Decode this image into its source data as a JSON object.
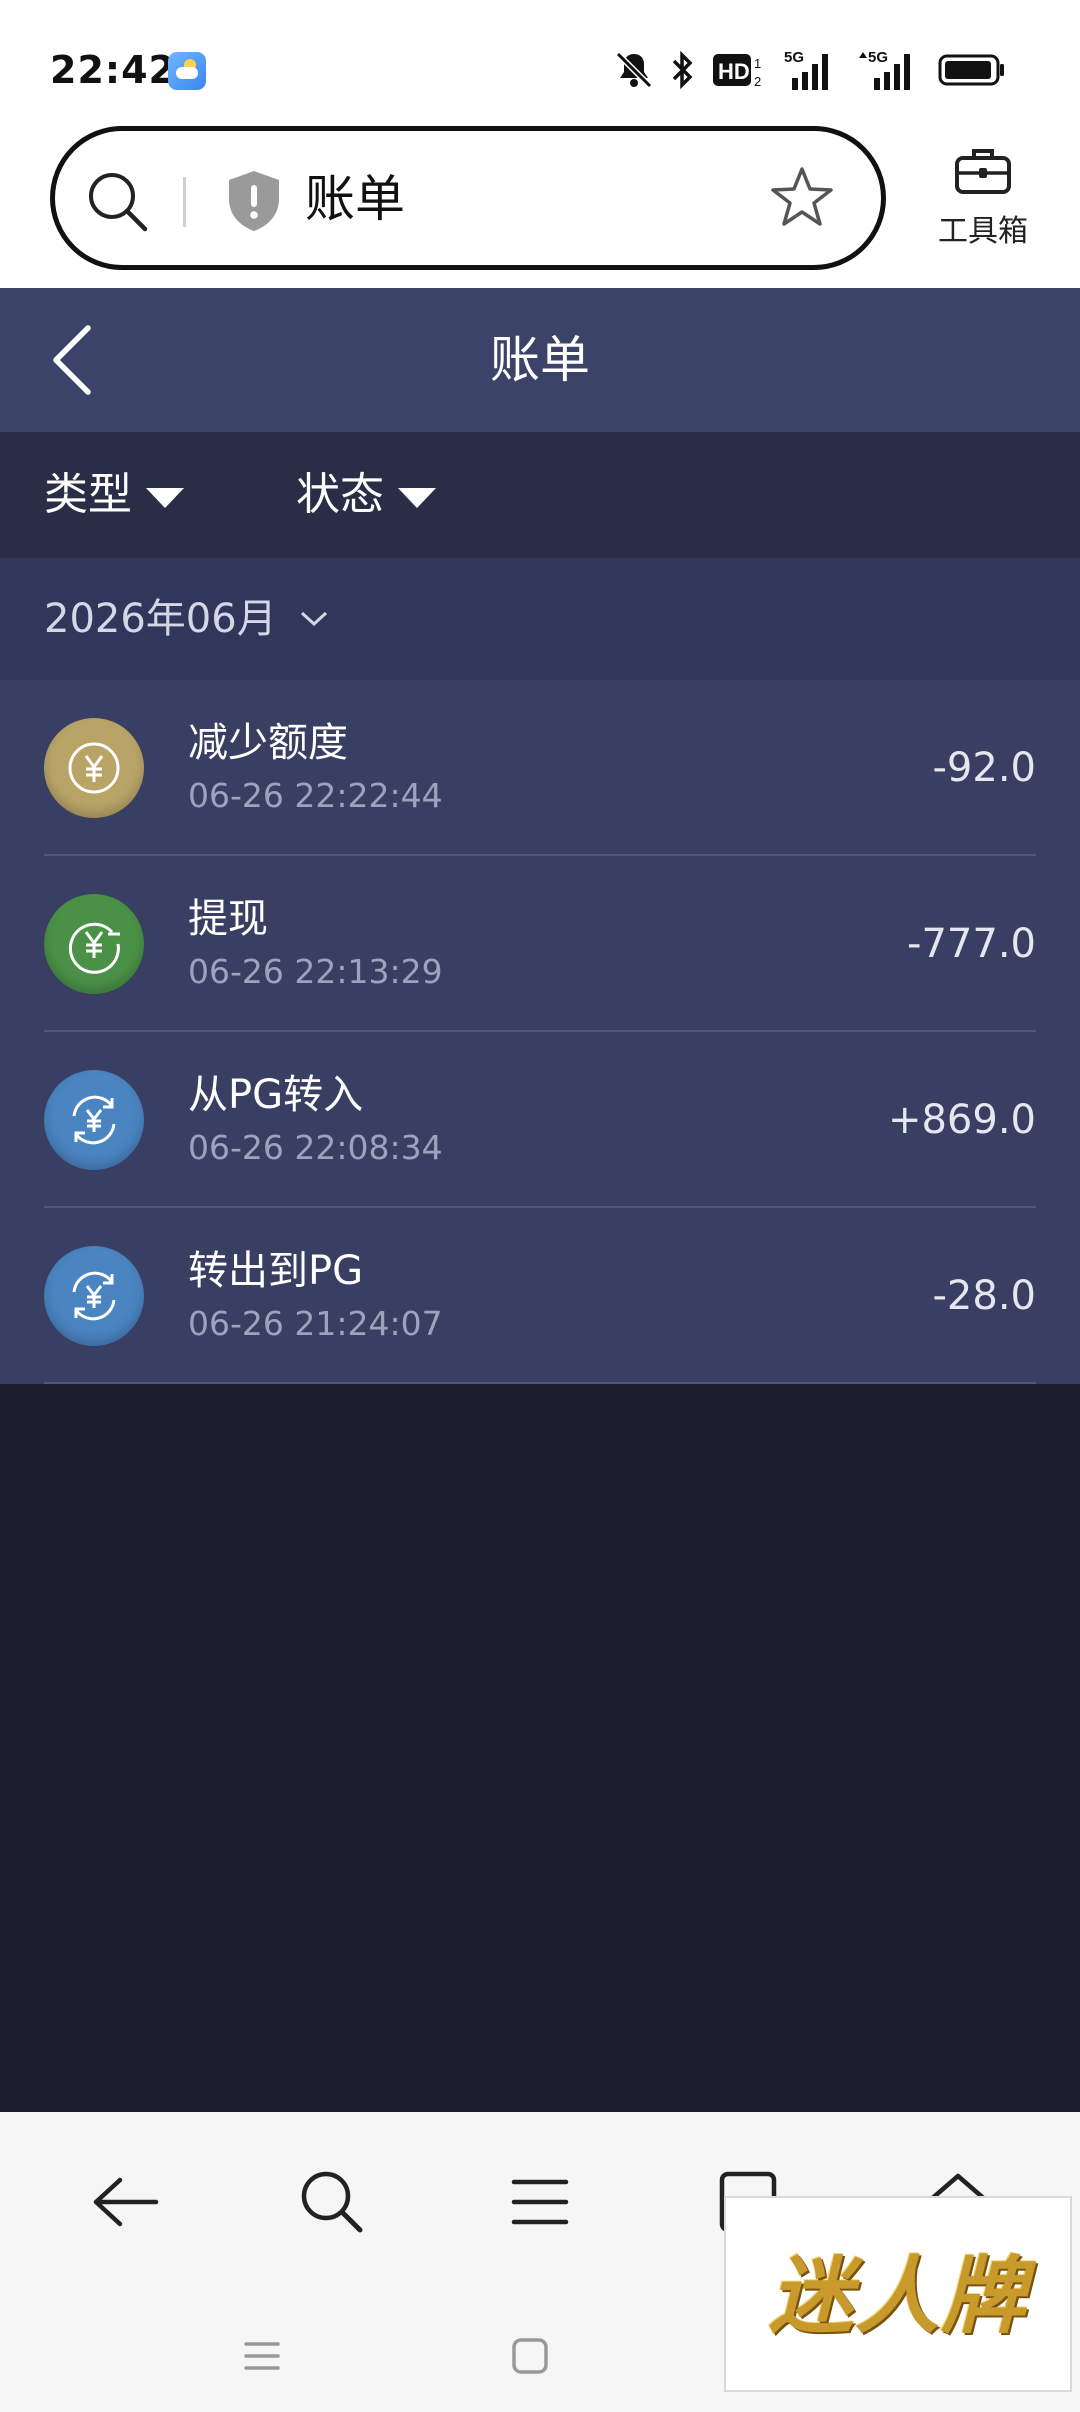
{
  "status_bar": {
    "time": "22:42",
    "icons": [
      "weather-icon",
      "mute-icon",
      "bluetooth-icon",
      "hd-icon",
      "signal-5g-icon",
      "signal-5g-icon",
      "battery-icon"
    ]
  },
  "browser": {
    "address_text": "账单",
    "toolbox_label": "工具箱"
  },
  "header": {
    "title": "账单"
  },
  "filters": {
    "type_label": "类型",
    "status_label": "状态"
  },
  "month": {
    "label": "2026年06月"
  },
  "transactions": [
    {
      "title": "减少额度",
      "time": "06-26 22:22:44",
      "amount": "-92.0",
      "icon": "yuan-icon",
      "color": "#b9a468"
    },
    {
      "title": "提现",
      "time": "06-26 22:13:29",
      "amount": "-777.0",
      "icon": "withdraw-icon",
      "color": "#4a9147"
    },
    {
      "title": "从PG转入",
      "time": "06-26 22:08:34",
      "amount": "+869.0",
      "icon": "transfer-icon",
      "color": "#4a84c1"
    },
    {
      "title": "转出到PG",
      "time": "06-26 21:24:07",
      "amount": "-28.0",
      "icon": "transfer-icon",
      "color": "#4a84c1"
    }
  ],
  "watermark": {
    "text": "迷人牌"
  },
  "colors": {
    "header_bg": "#3b4468",
    "filter_bg": "#292e46",
    "list_bg": "#393f62",
    "page_bg": "#1b1d2c"
  }
}
